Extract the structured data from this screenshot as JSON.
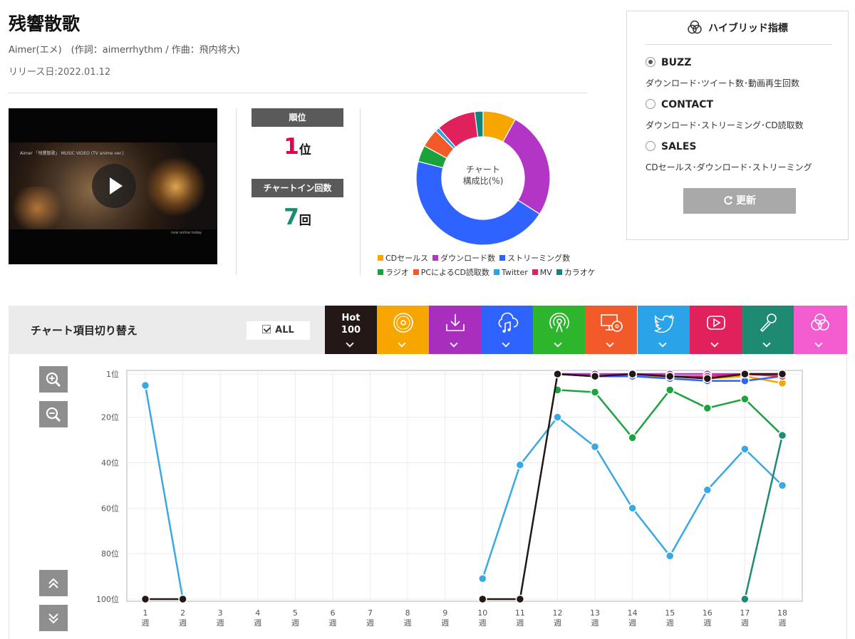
{
  "song": {
    "title": "残響散歌",
    "credits": "Aimer(エメ)　(作詞：aimerrhythm / 作曲：飛内将大)",
    "release": "リリース日:2022.01.12"
  },
  "video": {
    "caption": "Aimer 「残響散歌」 MUSIC VIDEO (TV anime ver.)",
    "corner": "now online today"
  },
  "stats": {
    "rank_label": "順位",
    "rank_value": "1",
    "rank_unit": "位",
    "rank_color": "#e5004f",
    "chartin_label": "チャートイン回数",
    "chartin_value": "7",
    "chartin_unit": "回",
    "chartin_color": "#1f8a72"
  },
  "composition": {
    "center_line1": "チャート",
    "center_line2": "構成比(%)",
    "slices": [
      {
        "name": "CDセールス",
        "value": 8,
        "color": "#f7a600"
      },
      {
        "name": "ダウンロード数",
        "value": 26,
        "color": "#b235c6"
      },
      {
        "name": "ストリーミング数",
        "value": 45,
        "color": "#2f63ff"
      },
      {
        "name": "ラジオ",
        "value": 4,
        "color": "#1aa33a"
      },
      {
        "name": "PCによるCD読取数",
        "value": 4.5,
        "color": "#f25a2a"
      },
      {
        "name": "Twitter",
        "value": 1,
        "color": "#2aa3e8"
      },
      {
        "name": "MV",
        "value": 9.5,
        "color": "#e0215c"
      },
      {
        "name": "カラオケ",
        "value": 2,
        "color": "#15857a"
      }
    ]
  },
  "hybrid": {
    "title": "ハイブリッド指標",
    "options": [
      {
        "label": "BUZZ",
        "desc": "ダウンロード･ツイート数･動画再生回数",
        "selected": true
      },
      {
        "label": "CONTACT",
        "desc": "ダウンロード･ストリーミング･CD読取数",
        "selected": false
      },
      {
        "label": "SALES",
        "desc": "CDセールス･ダウンロード･ストリーミング",
        "selected": false
      }
    ],
    "update_label": "更新"
  },
  "switcher": {
    "title": "チャート項目切り替え",
    "all_label": "ALL",
    "hot_line1": "Hot",
    "hot_line2": "100",
    "tabs": [
      {
        "icon": "hot100",
        "color": "#231815"
      },
      {
        "icon": "cd-icon",
        "color": "#f7a600"
      },
      {
        "icon": "download-icon",
        "color": "#a82fbd"
      },
      {
        "icon": "streaming-icon",
        "color": "#2f63ff"
      },
      {
        "icon": "radio-icon",
        "color": "#2eb52e"
      },
      {
        "icon": "pc-cd-icon",
        "color": "#f25a2a"
      },
      {
        "icon": "twitter-icon",
        "color": "#2aa3e8"
      },
      {
        "icon": "youtube-icon",
        "color": "#e0215c"
      },
      {
        "icon": "karaoke-icon",
        "color": "#1f8a72"
      },
      {
        "icon": "hybrid-icon",
        "color": "#f25ccf"
      }
    ]
  },
  "chart_data": {
    "type": "line",
    "y_axis": {
      "reversed": true,
      "ticks": [
        "1位",
        "20位",
        "40位",
        "60位",
        "80位",
        "100位"
      ],
      "tick_values": [
        1,
        20,
        40,
        60,
        80,
        100
      ],
      "range": [
        1,
        100
      ]
    },
    "x_labels": [
      "1",
      "2",
      "3",
      "4",
      "5",
      "6",
      "7",
      "8",
      "9",
      "10",
      "11",
      "12",
      "13",
      "14",
      "15",
      "16",
      "17",
      "18"
    ],
    "x_unit": "週",
    "grid": true,
    "series": [
      {
        "key": "twitter",
        "color": "#3aa9e3",
        "marker": "#3aa9e3",
        "values": [
          6,
          100,
          null,
          null,
          null,
          null,
          null,
          null,
          null,
          91,
          41,
          20,
          33,
          60,
          81,
          52,
          34,
          50
        ]
      },
      {
        "key": "radio",
        "color": "#1ba33c",
        "marker": "#1ba33c",
        "values": [
          null,
          null,
          null,
          null,
          null,
          null,
          null,
          null,
          null,
          null,
          null,
          8,
          9,
          29,
          8,
          16,
          12,
          28
        ]
      },
      {
        "key": "karaoke",
        "color": "#1f8a72",
        "marker": "#1f8a72",
        "values": [
          null,
          null,
          null,
          null,
          null,
          null,
          null,
          null,
          null,
          null,
          null,
          null,
          null,
          null,
          null,
          null,
          100,
          28
        ]
      },
      {
        "key": "cd",
        "color": "#f7a600",
        "marker": "#f7a600",
        "values": [
          null,
          null,
          null,
          null,
          null,
          null,
          null,
          null,
          null,
          null,
          null,
          1,
          2,
          2,
          2,
          3,
          2,
          5
        ]
      },
      {
        "key": "download",
        "color": "#b235c6",
        "marker": "#b235c6",
        "values": [
          null,
          null,
          null,
          null,
          null,
          null,
          null,
          null,
          null,
          null,
          null,
          1,
          1,
          1,
          1,
          1,
          1,
          1
        ]
      },
      {
        "key": "streaming",
        "color": "#2f63ff",
        "marker": "#2f63ff",
        "values": [
          null,
          null,
          null,
          null,
          null,
          null,
          null,
          null,
          null,
          null,
          null,
          1,
          2,
          2,
          3,
          4,
          4,
          2
        ]
      },
      {
        "key": "mv",
        "color": "#e0215c",
        "marker": "#e0215c",
        "values": [
          null,
          null,
          null,
          null,
          null,
          null,
          null,
          null,
          null,
          null,
          null,
          1,
          2,
          1,
          2,
          2,
          1,
          2
        ]
      },
      {
        "key": "hot100",
        "color": "#231815",
        "marker": "#231815",
        "values": [
          100,
          100,
          null,
          null,
          null,
          null,
          null,
          null,
          null,
          100,
          100,
          1,
          2,
          1,
          2,
          3,
          1,
          1
        ]
      }
    ]
  }
}
